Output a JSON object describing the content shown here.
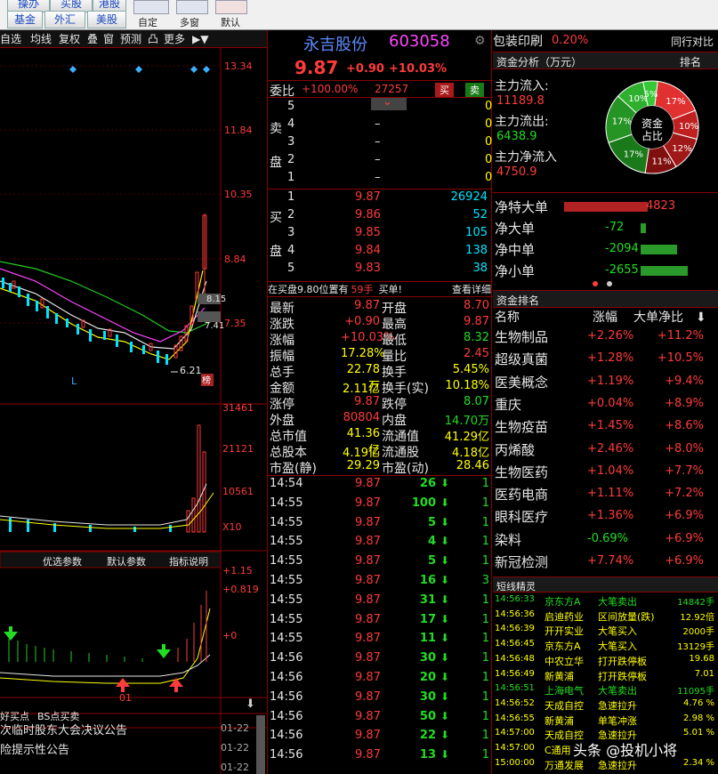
{
  "toolbar": {
    "btn_top": [
      "操办",
      "买股",
      "港股"
    ],
    "fund": "基金",
    "forex": "外汇",
    "us": "美股",
    "custom": "自定",
    "multi": "多窗",
    "default": "默认"
  },
  "chart_tabs": [
    "自选",
    "均线",
    "复权",
    "叠",
    "窗",
    "预测",
    "凸",
    "更多"
  ],
  "price_axis": [
    "13.34",
    "11.84",
    "10.35",
    "8.84",
    "7.35"
  ],
  "kline_marks": {
    "high": "8.15",
    "mid": "7.41",
    "low": "6.21",
    "L": "L",
    "rank": "榜"
  },
  "vol_axis": [
    "31461",
    "21121",
    "10561",
    "X10"
  ],
  "indicator_tabs": [
    "优选参数",
    "默认参数",
    "指标说明"
  ],
  "ind_axis": [
    "+1.15",
    "+0.819",
    "+0",
    "01"
  ],
  "bottom_tabs": [
    "好买点",
    "BS点买卖"
  ],
  "news": [
    {
      "t": "次临时股东大会决议公告",
      "d": "01-22"
    },
    {
      "t": "险提示性公告",
      "d": "01-22"
    },
    {
      "t": "",
      "d": "01-22"
    },
    {
      "t": "",
      "d": "01-22"
    }
  ],
  "stock": {
    "name": "永吉股份",
    "code": "603058",
    "price": "9.87",
    "chg": "+0.90",
    "pct": "+10.03%"
  },
  "weibi": {
    "label": "委比",
    "val": "+100.00%",
    "qty": "27257",
    "buy": "买",
    "sell": "卖"
  },
  "sell_label": [
    "卖",
    "盘"
  ],
  "buy_label": [
    "买",
    "盘"
  ],
  "sells": [
    {
      "n": "5",
      "p": "",
      "v": "0"
    },
    {
      "n": "4",
      "p": "–",
      "v": "0"
    },
    {
      "n": "3",
      "p": "–",
      "v": "0"
    },
    {
      "n": "2",
      "p": "–",
      "v": "0"
    },
    {
      "n": "1",
      "p": "–",
      "v": "0"
    }
  ],
  "buys": [
    {
      "n": "1",
      "p": "9.87",
      "v": "26924"
    },
    {
      "n": "2",
      "p": "9.86",
      "v": "52"
    },
    {
      "n": "3",
      "p": "9.85",
      "v": "105"
    },
    {
      "n": "4",
      "p": "9.84",
      "v": "138"
    },
    {
      "n": "5",
      "p": "9.83",
      "v": "38"
    }
  ],
  "bar_info": {
    "a": "在买盘9.80位置有",
    "b": "59手",
    "c": "买单!",
    "d": "查看详细"
  },
  "stats": [
    [
      "最新",
      "9.87",
      "开盘",
      "8.70"
    ],
    [
      "涨跌",
      "+0.90",
      "最高",
      "9.87"
    ],
    [
      "涨幅",
      "+10.03%",
      "最低",
      "8.32"
    ],
    [
      "振幅",
      "17.28%",
      "量比",
      "2.45"
    ],
    [
      "总手",
      "22.78万",
      "换手",
      "5.45%"
    ],
    [
      "金额",
      "2.11亿",
      "换手(实)",
      "10.18%"
    ],
    [
      "涨停",
      "9.87",
      "跌停",
      "8.07"
    ],
    [
      "外盘",
      "80804",
      "内盘",
      "14.70万"
    ],
    [
      "总市值",
      "41.36亿",
      "流通值",
      "41.29亿"
    ],
    [
      "总股本",
      "4.19亿",
      "流通股",
      "4.18亿"
    ],
    [
      "市盈(静)",
      "29.29",
      "市盈(动)",
      "28.46"
    ]
  ],
  "ticks": [
    {
      "t": "14:54",
      "p": "9.87",
      "v": "26",
      "c": "1"
    },
    {
      "t": "14:55",
      "p": "9.87",
      "v": "100",
      "c": "1"
    },
    {
      "t": "14:55",
      "p": "9.87",
      "v": "5",
      "c": "1"
    },
    {
      "t": "14:55",
      "p": "9.87",
      "v": "4",
      "c": "1"
    },
    {
      "t": "14:55",
      "p": "9.87",
      "v": "5",
      "c": "1"
    },
    {
      "t": "14:55",
      "p": "9.87",
      "v": "16",
      "c": "3"
    },
    {
      "t": "14:55",
      "p": "9.87",
      "v": "31",
      "c": "1"
    },
    {
      "t": "14:55",
      "p": "9.87",
      "v": "17",
      "c": "1"
    },
    {
      "t": "14:55",
      "p": "9.87",
      "v": "11",
      "c": "1"
    },
    {
      "t": "14:56",
      "p": "9.87",
      "v": "30",
      "c": "1"
    },
    {
      "t": "14:56",
      "p": "9.87",
      "v": "20",
      "c": "1"
    },
    {
      "t": "14:56",
      "p": "9.87",
      "v": "30",
      "c": "1"
    },
    {
      "t": "14:56",
      "p": "9.87",
      "v": "50",
      "c": "1"
    },
    {
      "t": "14:56",
      "p": "9.87",
      "v": "22",
      "c": "1"
    },
    {
      "t": "14:56",
      "p": "9.87",
      "v": "13",
      "c": "1"
    }
  ],
  "sector": {
    "name": "包装印刷",
    "pct": "0.20%",
    "rank": "同行对比"
  },
  "fund": {
    "title": "资金分析（万元）",
    "rank": "排名",
    "in_l": "主力流入:",
    "in_v": "11189.8",
    "out_l": "主力流出:",
    "out_v": "6438.9",
    "net_l": "主力净流入",
    "net_v": "4750.9",
    "center": [
      "资金",
      "占比"
    ],
    "slices": [
      {
        "v": 17,
        "c": "#e03030",
        "l": "17%"
      },
      {
        "v": 10,
        "c": "#c02020",
        "l": "10%"
      },
      {
        "v": 12,
        "c": "#a01818",
        "l": "12%"
      },
      {
        "v": 11,
        "c": "#801010",
        "l": "11%"
      },
      {
        "v": 17,
        "c": "#1a7a1a",
        "l": "17%"
      },
      {
        "v": 17,
        "c": "#249424",
        "l": "17%"
      },
      {
        "v": 10,
        "c": "#2eb02e",
        "l": "10%"
      },
      {
        "v": 5,
        "c": "#36c836",
        "l": "5%"
      }
    ]
  },
  "net": [
    {
      "l": "净特大单",
      "v": "4823",
      "s": 1,
      "f": 0.8
    },
    {
      "l": "净大单",
      "v": "-72",
      "s": -1,
      "f": 0.05
    },
    {
      "l": "净中单",
      "v": "-2094",
      "s": -1,
      "f": 0.35
    },
    {
      "l": "净小单",
      "v": "-2655",
      "s": -1,
      "f": 0.45
    }
  ],
  "board": {
    "title": "资金排名",
    "h": [
      "名称",
      "涨幅",
      "大单净比"
    ],
    "rows": [
      [
        "生物制品",
        "+2.26%",
        "+11.2%"
      ],
      [
        "超级真菌",
        "+1.28%",
        "+10.5%"
      ],
      [
        "医美概念",
        "+1.19%",
        "+9.4%"
      ],
      [
        "重庆",
        "+0.04%",
        "+8.9%"
      ],
      [
        "生物疫苗",
        "+1.45%",
        "+8.6%"
      ],
      [
        "丙烯酸",
        "+2.46%",
        "+8.0%"
      ],
      [
        "生物医药",
        "+1.04%",
        "+7.7%"
      ],
      [
        "医药电商",
        "+1.11%",
        "+7.2%"
      ],
      [
        "眼科医疗",
        "+1.36%",
        "+6.9%"
      ],
      [
        "染料",
        "-0.69%",
        "+6.9%"
      ],
      [
        "新冠检测",
        "+7.74%",
        "+6.9%"
      ]
    ]
  },
  "sprite": {
    "title": "短线精灵",
    "rows": [
      [
        "14:56:33",
        "京东方A",
        "大笔卖出",
        "14842手"
      ],
      [
        "14:56:36",
        "启迪药业",
        "区间放量(跌)",
        "12.92倍"
      ],
      [
        "14:56:39",
        "开开实业",
        "大笔买入",
        "2000手"
      ],
      [
        "14:56:45",
        "京东方A",
        "大笔买入",
        "13129手"
      ],
      [
        "14:56:48",
        "中农立华",
        "打开跌停板",
        "19.68"
      ],
      [
        "14:56:49",
        "新黄浦",
        "打开跌停板",
        "7.01"
      ],
      [
        "14:56:51",
        "上海电气",
        "大笔卖出",
        "11095手"
      ],
      [
        "14:56:52",
        "天成自控",
        "急速拉升",
        "4.76 %"
      ],
      [
        "14:56:55",
        "新黄浦",
        "单笔冲涨",
        "2.98 %"
      ],
      [
        "14:57:00",
        "天成自控",
        "急速拉升",
        "5.01 %"
      ],
      [
        "14:57:00",
        "C通用",
        "",
        ""
      ],
      [
        "15:00:00",
        "万通发展",
        "急速拉升",
        "2.34 %"
      ]
    ]
  },
  "watermark": "头条 @投机小将"
}
